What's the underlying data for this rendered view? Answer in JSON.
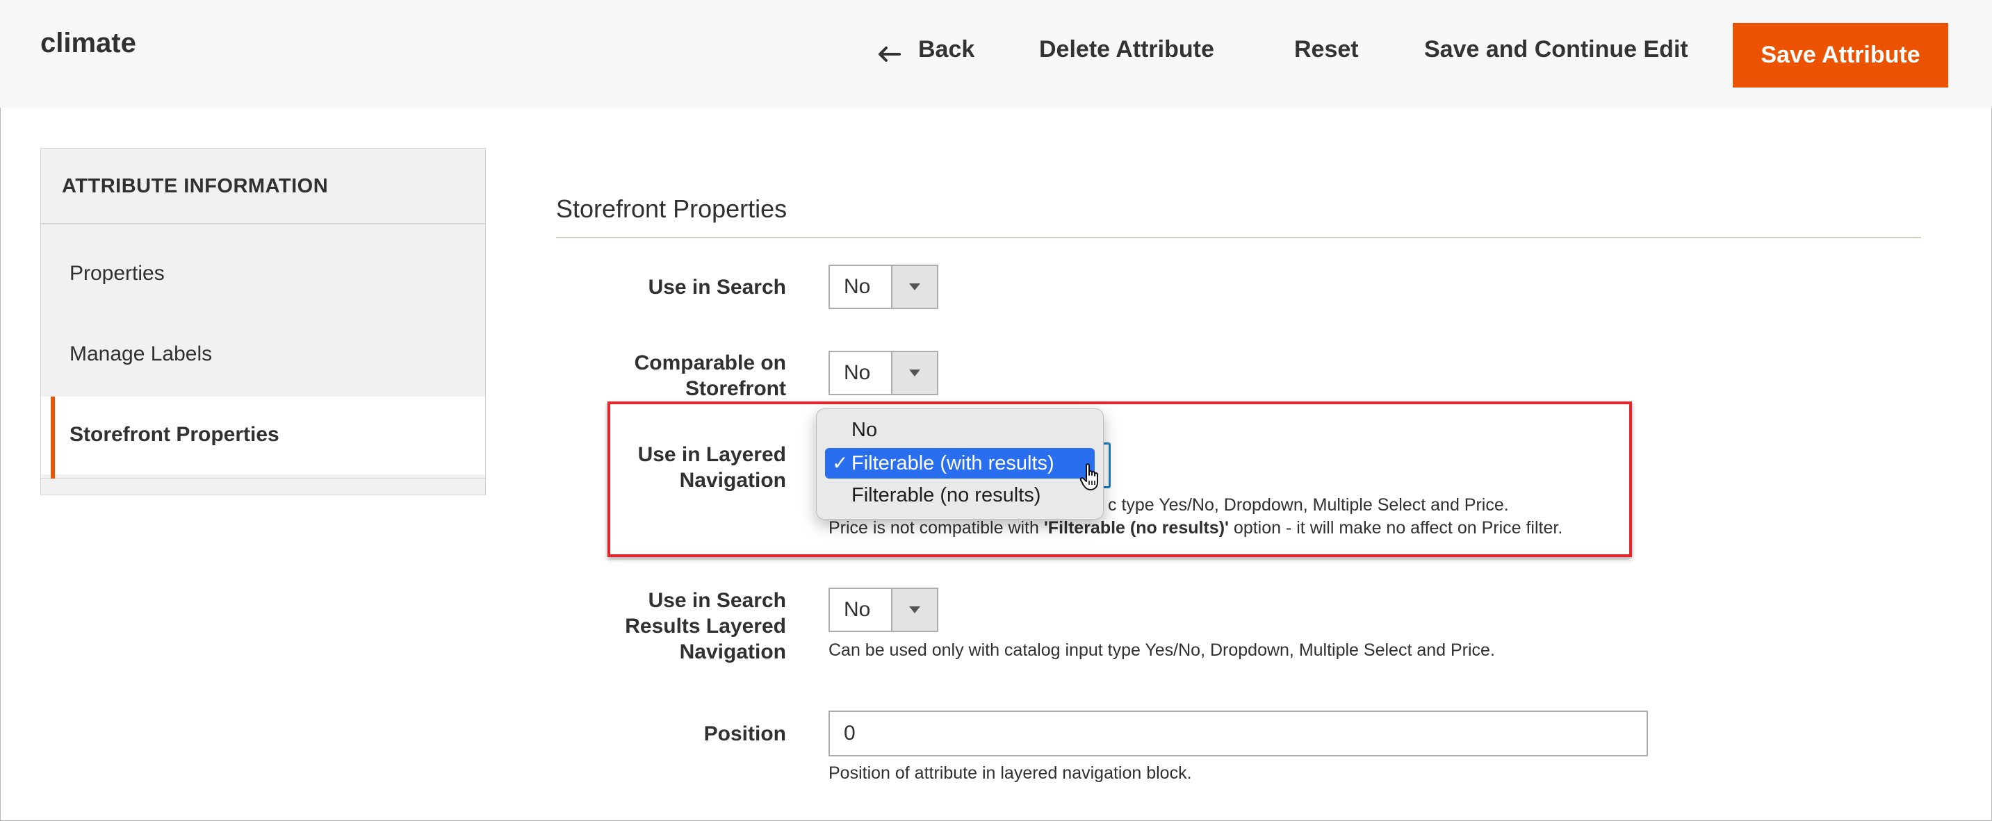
{
  "header": {
    "title": "climate",
    "back_label": "Back",
    "delete_label": "Delete Attribute",
    "reset_label": "Reset",
    "save_continue_label": "Save and Continue Edit",
    "save_label": "Save Attribute",
    "accent_color": "#eb5202"
  },
  "sidebar": {
    "heading": "ATTRIBUTE INFORMATION",
    "items": [
      {
        "label": "Properties",
        "active": false
      },
      {
        "label": "Manage Labels",
        "active": false
      },
      {
        "label": "Storefront Properties",
        "active": true
      }
    ]
  },
  "main": {
    "section_title": "Storefront Properties",
    "fields": {
      "use_in_search": {
        "label": "Use in Search",
        "value": "No"
      },
      "comparable": {
        "label_line1": "Comparable on",
        "label_line2": "Storefront",
        "value": "No"
      },
      "layered_nav": {
        "label_line1": "Use in Layered",
        "label_line2": "Navigation",
        "note_tail": "c type Yes/No, Dropdown, Multiple Select and Price.",
        "note2_pre": "Price is not compatible with ",
        "note2_bold": "'Filterable (no results)'",
        "note2_post": " option - it will make no affect on Price filter.",
        "options": [
          "No",
          "Filterable (with results)",
          "Filterable (no results)"
        ],
        "selected": "Filterable (with results)",
        "check": "✓"
      },
      "search_results_layered": {
        "label_line1": "Use in Search",
        "label_line2": "Results Layered",
        "label_line3": "Navigation",
        "value": "No",
        "note": "Can be used only with catalog input type Yes/No, Dropdown, Multiple Select and Price."
      },
      "position": {
        "label": "Position",
        "value": "0",
        "note": "Position of attribute in layered navigation block."
      }
    }
  },
  "highlight_color": "#e3262b"
}
